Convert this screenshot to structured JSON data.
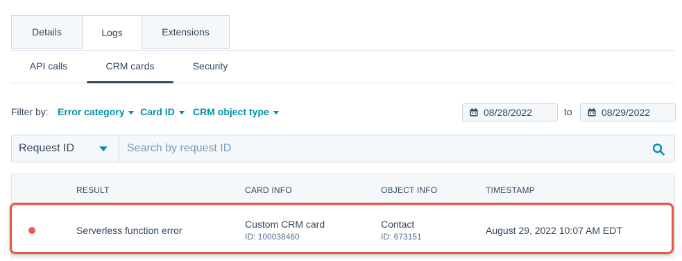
{
  "tabs": [
    {
      "label": "Details"
    },
    {
      "label": "Logs",
      "active": true
    },
    {
      "label": "Extensions"
    }
  ],
  "subtabs": [
    {
      "label": "API calls"
    },
    {
      "label": "CRM cards",
      "active": true
    },
    {
      "label": "Security"
    }
  ],
  "filters": {
    "label": "Filter by:",
    "dropdowns": [
      "Error category",
      "Card ID",
      "CRM object type"
    ],
    "date_from": "08/28/2022",
    "to_label": "to",
    "date_to": "08/29/2022"
  },
  "search": {
    "select_value": "Request ID",
    "placeholder": "Search by request ID"
  },
  "table": {
    "columns": [
      "RESULT",
      "CARD INFO",
      "OBJECT INFO",
      "TIMESTAMP"
    ],
    "rows": [
      {
        "status": "error",
        "result": "Serverless function error",
        "card_name": "Custom CRM card",
        "card_id": "ID: 100038460",
        "object_type": "Contact",
        "object_id": "ID: 673151",
        "timestamp": "August 29, 2022 10:07 AM EDT"
      }
    ]
  },
  "colors": {
    "accent": "#0091ae",
    "text": "#33475b",
    "error_dot": "#f2545b",
    "highlight": "#e5573f"
  },
  "icons": [
    "calendar-icon",
    "dropdown-caret-icon",
    "search-icon"
  ]
}
